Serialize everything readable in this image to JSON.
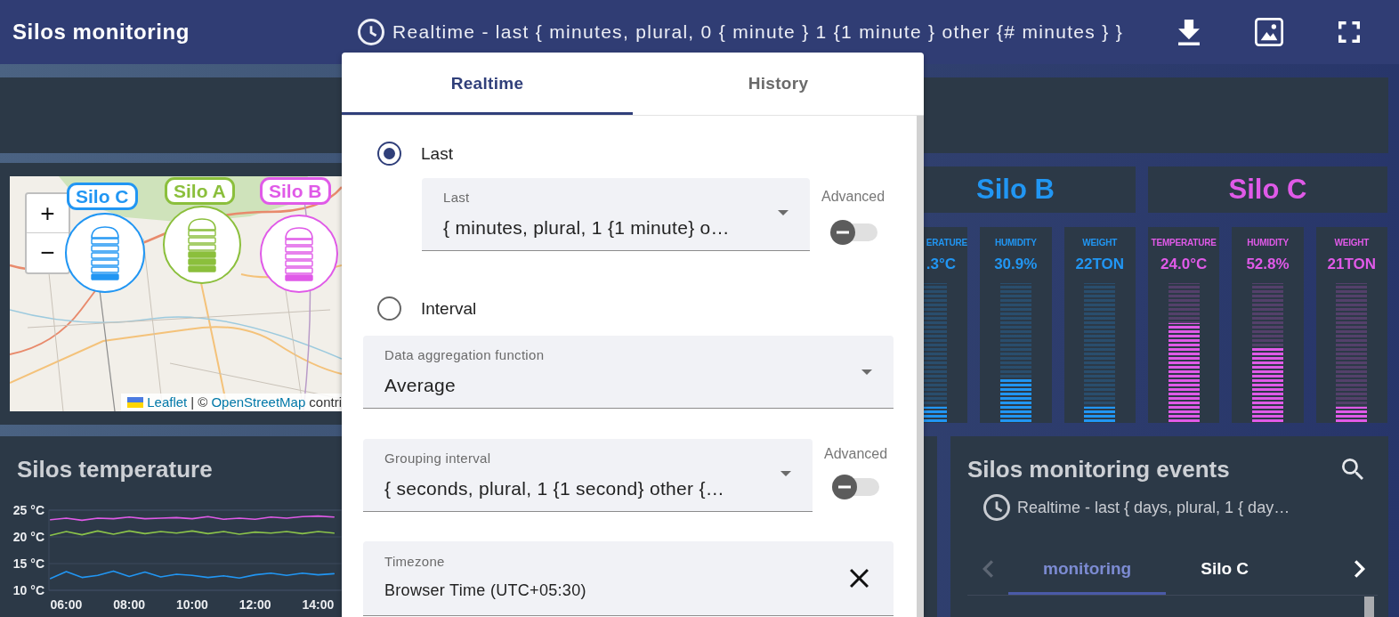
{
  "top_bar": {
    "title": "Silos monitoring",
    "timewindow": "Realtime - last { minutes, plural, 0 { minute } 1 {1 minute } other {# minutes } }"
  },
  "map": {
    "zoom_in": "+",
    "zoom_out": "−",
    "markers": [
      {
        "label": "Silo C",
        "color": "#2196f3",
        "level": 0.15
      },
      {
        "label": "Silo A",
        "color": "#8bbf3c",
        "level": 0.5
      },
      {
        "label": "Silo B",
        "color": "#e05ae8",
        "level": 0.15
      }
    ],
    "attribution": {
      "leaflet_link": "Leaflet",
      "separator": "| ©",
      "osm_link": "OpenStreetMap",
      "trailing": "contri"
    }
  },
  "silo_panels": [
    {
      "title": "Silo B",
      "color": "#2196f3",
      "metrics": [
        {
          "kind": "partial",
          "label": "ERATURE",
          "value": ".3°C",
          "level": 0.11
        },
        {
          "kind": "full",
          "label": "HUMIDITY",
          "value": "30.9%",
          "level": 0.31
        },
        {
          "kind": "full",
          "label": "WEIGHT",
          "value": "22TON",
          "level": 0.11
        }
      ]
    },
    {
      "title": "Silo C",
      "color": "#e05ae8",
      "metrics": [
        {
          "kind": "full",
          "label": "TEMPERATURE",
          "value": "24.0°C",
          "level": 0.71
        },
        {
          "kind": "full",
          "label": "HUMIDITY",
          "value": "52.8%",
          "level": 0.54
        },
        {
          "kind": "full",
          "label": "WEIGHT",
          "value": "21TON",
          "level": 0.11
        }
      ]
    }
  ],
  "temperature_chart": {
    "chart_data": {
      "type": "line",
      "title": "Silos temperature",
      "x": [
        5.5,
        6,
        6.5,
        7,
        7.5,
        8,
        8.5,
        9,
        9.5,
        10,
        10.5,
        11,
        11.5,
        12,
        12.5,
        13,
        13.5,
        14,
        14.5
      ],
      "series": [
        {
          "color": "#e05ae8",
          "values": [
            23.2,
            23.5,
            23.1,
            23.5,
            23.4,
            23.7,
            23.4,
            23.5,
            23.6,
            23.4,
            23.8,
            23.3,
            23.5,
            23.3,
            23.7,
            23.5,
            23.8,
            23.9,
            23.7
          ]
        },
        {
          "color": "#8bc34a",
          "values": [
            20.3,
            21.0,
            20.4,
            21.1,
            20.5,
            21.1,
            20.6,
            21.0,
            20.7,
            21.1,
            20.6,
            21.0,
            20.5,
            20.9,
            20.7,
            21.0,
            20.6,
            21.0,
            20.7
          ]
        },
        {
          "color": "#2196f3",
          "values": [
            12.2,
            13.5,
            12.4,
            12.8,
            13.6,
            12.6,
            13.4,
            12.5,
            13.0,
            12.8,
            12.4,
            12.7,
            12.3,
            12.9,
            13.2,
            12.8,
            13.2,
            12.9,
            13.1
          ]
        }
      ],
      "xlim": [
        5.45,
        14.75
      ],
      "ylim": [
        10,
        25
      ],
      "xticks": [
        {
          "value": 6,
          "label": "06:00"
        },
        {
          "value": 8,
          "label": "08:00"
        },
        {
          "value": 10,
          "label": "10:00"
        },
        {
          "value": 12,
          "label": "12:00"
        },
        {
          "value": 14,
          "label": "14:00"
        }
      ],
      "yticks": [
        {
          "value": 25,
          "label": "25 °C"
        },
        {
          "value": 20,
          "label": "20 °C"
        },
        {
          "value": 15,
          "label": "15 °C"
        },
        {
          "value": 10,
          "label": "10 °C"
        }
      ]
    }
  },
  "events": {
    "title": "Silos monitoring events",
    "timewindow": "Realtime - last { days, plural, 1 { day…",
    "tab_scroll": [
      {
        "kind": "prev",
        "disabled": true
      },
      {
        "kind": "next",
        "disabled": false
      }
    ],
    "tabs": [
      {
        "label": "monitoring",
        "selected": true
      },
      {
        "label": "Silo C",
        "selected": false
      }
    ]
  },
  "timewindow_popup": {
    "tabs": [
      {
        "label": "Realtime",
        "selected": true
      },
      {
        "label": "History",
        "selected": false
      }
    ],
    "modes": [
      {
        "label": "Last",
        "selected": true
      },
      {
        "label": "Interval",
        "selected": false
      }
    ],
    "last_select": {
      "label": "Last",
      "value": "{ minutes, plural, 1 {1 minute} o…"
    },
    "last_advanced": {
      "label": "Advanced",
      "on": false
    },
    "aggregation_select": {
      "label": "Data aggregation function",
      "value": "Average"
    },
    "grouping_select": {
      "label": "Grouping interval",
      "value": "{ seconds, plural, 1 {1 second} other {…"
    },
    "grouping_advanced": {
      "label": "Advanced",
      "on": false
    },
    "timezone": {
      "label": "Timezone",
      "value": "Browser Time (UTC+05:30)"
    }
  }
}
